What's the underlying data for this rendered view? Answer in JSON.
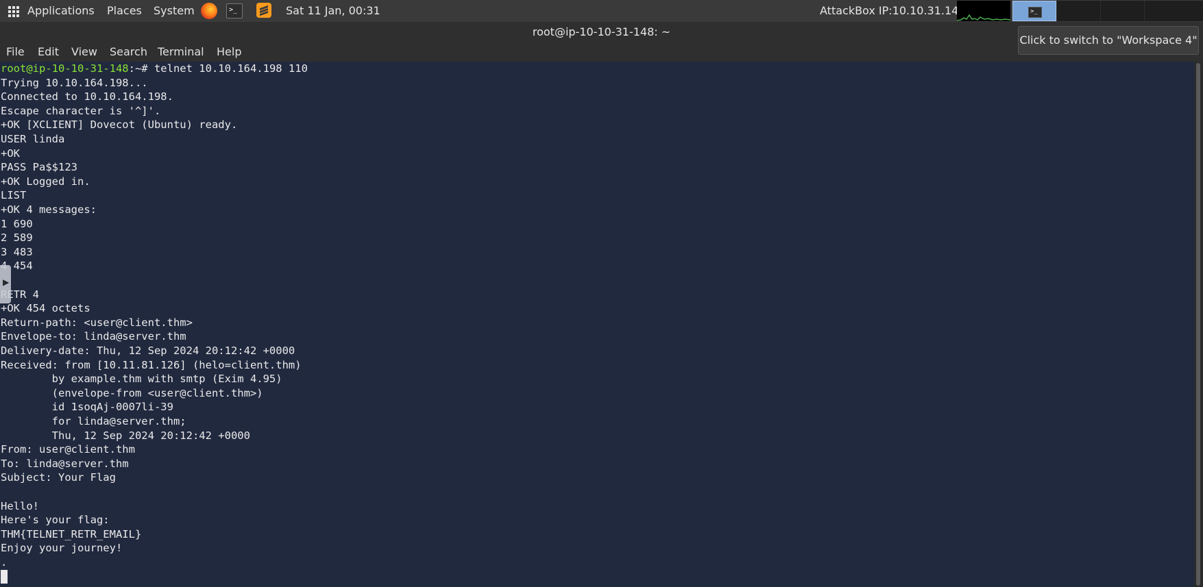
{
  "top_panel": {
    "applications": "Applications",
    "places": "Places",
    "system": "System",
    "datetime": "Sat 11 Jan, 00:31",
    "attackbox_ip": "AttackBox IP:10.10.31.148"
  },
  "window": {
    "title": "root@ip-10-10-31-148: ~"
  },
  "menu": [
    "File",
    "Edit",
    "View",
    "Search",
    "Terminal",
    "Help"
  ],
  "tooltip": "Click to switch to \"Workspace 4\"",
  "terminal": {
    "prompt": "root@ip-10-10-31-148",
    "prompt_suffix": ":~# telnet 10.10.164.198 110",
    "lines": [
      "Trying 10.10.164.198...",
      "Connected to 10.10.164.198.",
      "Escape character is '^]'.",
      "+OK [XCLIENT] Dovecot (Ubuntu) ready.",
      "USER linda",
      "+OK",
      "PASS Pa$$123",
      "+OK Logged in.",
      "LIST",
      "+OK 4 messages:",
      "1 690",
      "2 589",
      "3 483",
      "4 454",
      ".",
      "RETR 4",
      "+OK 454 octets",
      "Return-path: <user@client.thm>",
      "Envelope-to: linda@server.thm",
      "Delivery-date: Thu, 12 Sep 2024 20:12:42 +0000",
      "Received: from [10.11.81.126] (helo=client.thm)",
      "        by example.thm with smtp (Exim 4.95)",
      "        (envelope-from <user@client.thm>)",
      "        id 1soqAj-0007li-39",
      "        for linda@server.thm;",
      "        Thu, 12 Sep 2024 20:12:42 +0000",
      "From: user@client.thm",
      "To: linda@server.thm",
      "Subject: Your Flag",
      "",
      "Hello!",
      "Here's your flag:",
      "THM{TELNET_RETR_EMAIL}",
      "Enjoy your journey!",
      "."
    ]
  }
}
